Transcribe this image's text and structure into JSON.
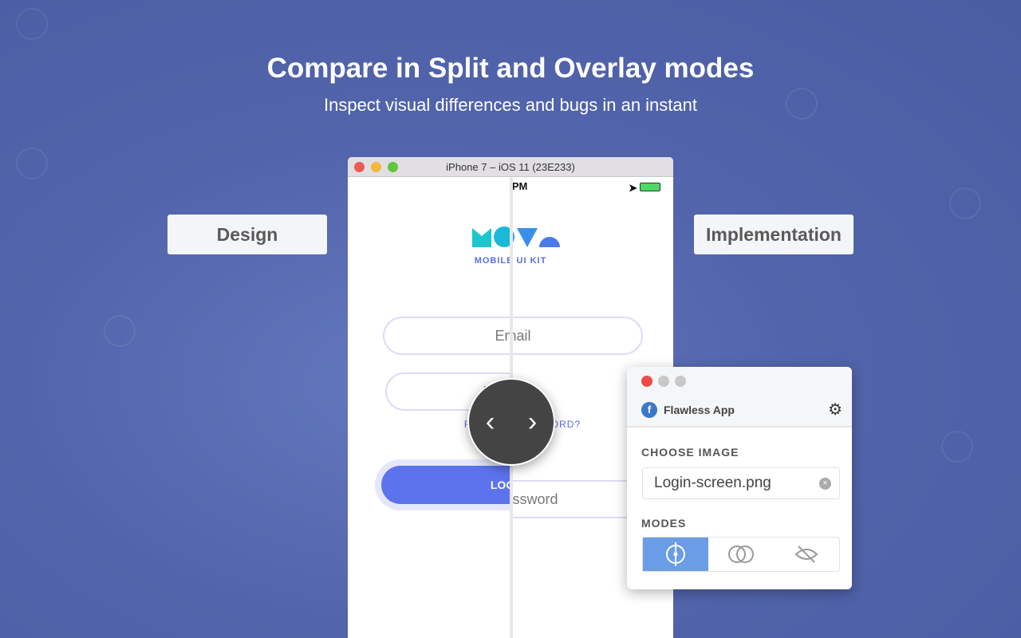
{
  "hero": {
    "title": "Compare in Split and Overlay modes",
    "subtitle": "Inspect visual differences and bugs in an instant"
  },
  "labels": {
    "left": "Design",
    "right": "Implementation"
  },
  "simulator": {
    "title": "iPhone 7 – iOS 11 (23E233)"
  },
  "design": {
    "kit": "MOBILE UI KIT",
    "email": "Email",
    "password": "Password",
    "forgot": "FORGOT PASSWORD?",
    "login": "LOG IN"
  },
  "implementation": {
    "time": "2 PM",
    "kit": "MOBILE UI KIT",
    "email": "Email",
    "password": "Password",
    "forgot": "FORGOT PASSWORD?"
  },
  "panel": {
    "app_name": "Flawless App",
    "choose_label": "CHOOSE IMAGE",
    "file": "Login-screen.png",
    "modes_label": "MODES",
    "modes": [
      "split",
      "overlay",
      "hide"
    ],
    "active_mode": "split"
  },
  "colors": {
    "accent": "#5d73ee",
    "mode_active": "#6a9de6",
    "background": "#5264ab"
  }
}
